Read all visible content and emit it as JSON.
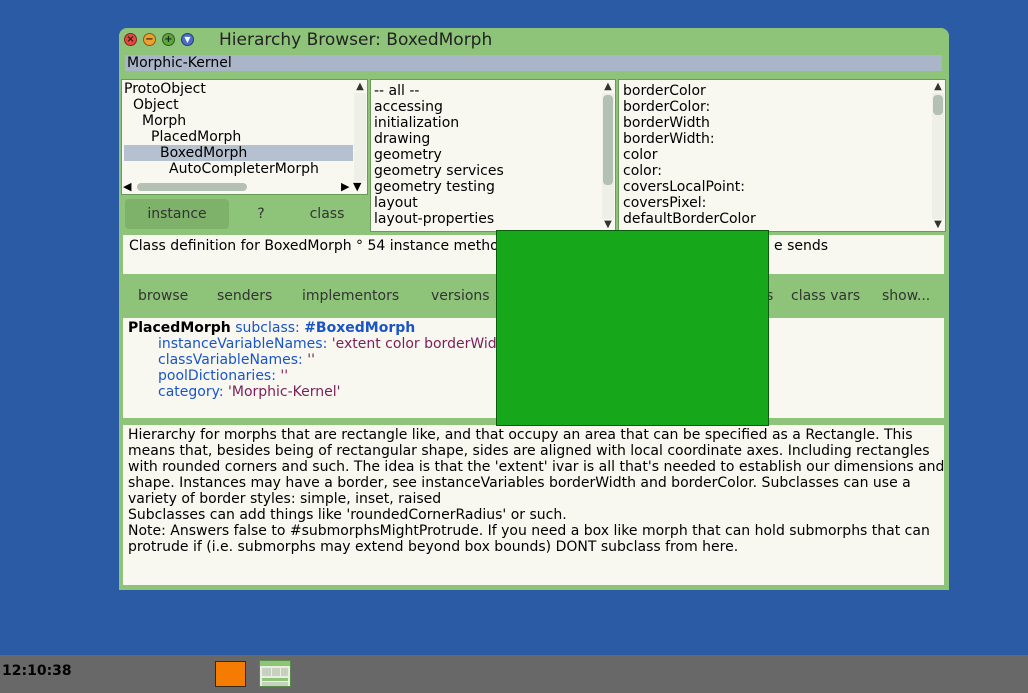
{
  "window": {
    "title": "Hierarchy Browser: BoxedMorph",
    "category": "Morphic-Kernel"
  },
  "class_list": {
    "items": [
      {
        "label": "ProtoObject",
        "indent": 0
      },
      {
        "label": "Object",
        "indent": 1
      },
      {
        "label": "Morph",
        "indent": 2
      },
      {
        "label": "PlacedMorph",
        "indent": 3
      },
      {
        "label": "BoxedMorph",
        "indent": 4,
        "selected": true
      },
      {
        "label": "AutoCompleterMorph",
        "indent": 5
      }
    ]
  },
  "category_list": {
    "items": [
      "-- all --",
      "accessing",
      "initialization",
      "drawing",
      "geometry",
      "geometry services",
      "geometry testing",
      "layout",
      "layout-properties"
    ]
  },
  "method_list": {
    "items": [
      "borderColor",
      "borderColor:",
      "borderWidth",
      "borderWidth:",
      "color",
      "color:",
      "coversLocalPoint:",
      "coversPixel:",
      "defaultBorderColor"
    ]
  },
  "tabs": {
    "instance": "instance",
    "help": "?",
    "class": "class"
  },
  "definition_info": {
    "left": "Class definition for BoxedMorph ° 54 instance methodo",
    "right": "e sends"
  },
  "buttons": {
    "browse": "browse",
    "senders": "senders",
    "implementors": "implementors",
    "versions": "versions",
    "partial": "s",
    "class_vars": "class vars",
    "show": "show..."
  },
  "code": {
    "superclass": "PlacedMorph",
    "subclass_kw": "subclass:",
    "subclass_name": "#BoxedMorph",
    "ivn_kw": "instanceVariableNames:",
    "ivn_val": "'extent color borderWidt",
    "cvn_kw": "classVariableNames:",
    "cvn_val": "''",
    "pd_kw": "poolDictionaries:",
    "pd_val": "''",
    "cat_kw": "category:",
    "cat_val": "'Morphic-Kernel'"
  },
  "comment": {
    "lines": [
      "Hierarchy for morphs that are rectangle like, and that occupy an area that can be specified as a Rectangle. This",
      "means that, besides being of rectangular shape, sides are aligned with local coordinate axes. Including rectangles",
      "with rounded corners and such. The idea is that the 'extent' ivar is all that's needed to establish our dimensions and",
      "shape. Instances may have a border, see instanceVariables borderWidth and borderColor. Subclasses can use a",
      "variety of border styles: simple, inset, raised",
      "Subclasses can add things like 'roundedCornerRadius' or such.",
      "Note: Answers false to #submorphsMightProtrude. If you need a box like morph that can hold submorphs that can",
      "protrude if (i.e. submorphs may extend beyond box bounds) DONT subclass from here."
    ]
  },
  "taskbar": {
    "clock": "12:10:38"
  },
  "colors": {
    "desktop": "#2c5ba6",
    "window": "#8ec47a",
    "overlay": "#16a81a",
    "taskbar": "#686868"
  }
}
